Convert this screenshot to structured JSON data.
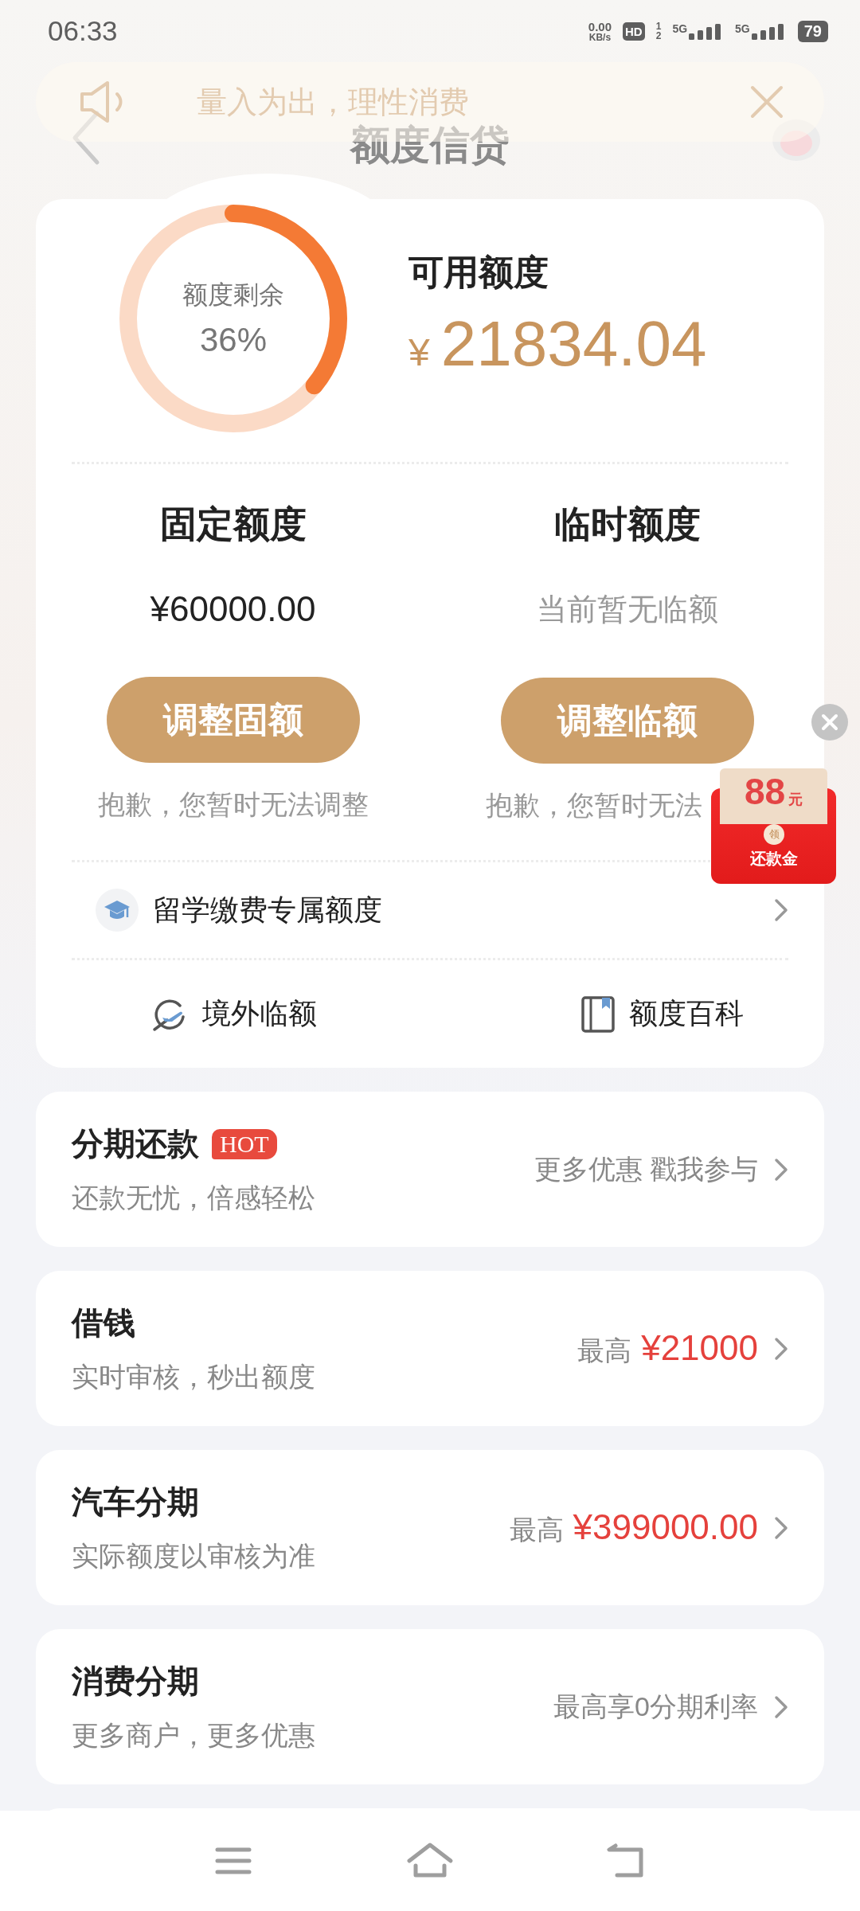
{
  "status_bar": {
    "time": "06:33",
    "net_speed_value": "0.00",
    "net_speed_unit": "KB/s",
    "hd": "HD",
    "sim_slots": [
      "1",
      "2"
    ],
    "networks": [
      "5G",
      "5G"
    ],
    "battery": "79"
  },
  "banner": {
    "text": "量入为出，理性消费"
  },
  "header": {
    "title": "额度信贷"
  },
  "quota": {
    "ring_label": "额度剩余",
    "ring_percent": "36%",
    "level": 0.36,
    "available_label": "可用额度",
    "currency": "¥",
    "available_amount": "21834.04"
  },
  "columns": [
    {
      "title": "固定额度",
      "value": "¥60000.00",
      "kind": "amount",
      "button": "调整固额",
      "note": "抱歉，您暂时无法调整"
    },
    {
      "title": "临时额度",
      "value": "当前暂无临额",
      "kind": "hint",
      "button": "调整临额",
      "note": "抱歉，您暂时无法"
    }
  ],
  "red_packet": {
    "amount": "88",
    "unit": "元",
    "seal": "领",
    "label": "还款金"
  },
  "study_row": {
    "label": "留学缴费专属额度"
  },
  "links": [
    {
      "label": "境外临额",
      "kind": "plane"
    },
    {
      "label": "额度百科",
      "kind": "book"
    }
  ],
  "products": [
    {
      "title": "分期还款",
      "badge": "HOT",
      "subtitle": "还款无忧，倍感轻松",
      "right": [
        {
          "text": "更多优惠 戳我参与",
          "kind": "note"
        }
      ]
    },
    {
      "title": "借钱",
      "subtitle": "实时审核，秒出额度",
      "right": [
        {
          "text": "最高",
          "kind": "note"
        },
        {
          "text": "¥21000",
          "kind": "price"
        }
      ]
    },
    {
      "title": "汽车分期",
      "subtitle": "实际额度以审核为准",
      "right": [
        {
          "text": "最高",
          "kind": "note"
        },
        {
          "text": "¥399000.00",
          "kind": "price"
        }
      ]
    },
    {
      "title": "消费分期",
      "subtitle": "更多商户，更多优惠",
      "right": [
        {
          "text": "最高享0分期利率",
          "kind": "note"
        }
      ]
    }
  ]
}
